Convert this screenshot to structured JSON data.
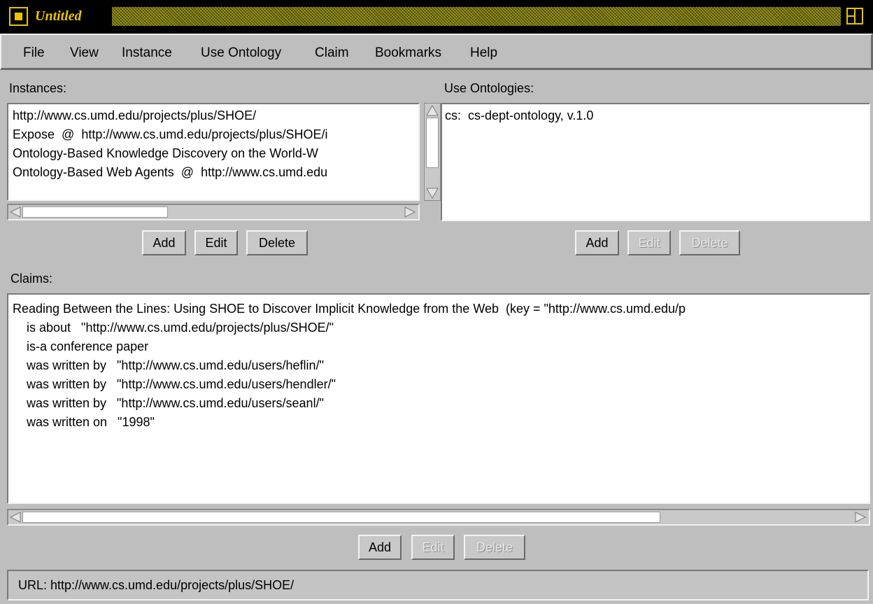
{
  "window": {
    "title": "Untitled",
    "system_menu_icon": "window-menu-icon",
    "maximize_icon": "maximize-icon"
  },
  "menubar": {
    "items": [
      "File",
      "View",
      "Instance",
      "Use Ontology",
      "Claim",
      "Bookmarks",
      "Help"
    ]
  },
  "instances": {
    "label": "Instances:",
    "items": [
      "http://www.cs.umd.edu/projects/plus/SHOE/",
      "Expose  @  http://www.cs.umd.edu/projects/plus/SHOE/i",
      "Ontology-Based Knowledge Discovery on the World-W",
      "Ontology-Based Web Agents  @  http://www.cs.umd.edu"
    ],
    "buttons": {
      "add": "Add",
      "edit": "Edit",
      "delete": "Delete"
    }
  },
  "ontologies": {
    "label": "Use Ontologies:",
    "items": [
      "cs:  cs-dept-ontology, v.1.0"
    ],
    "buttons": {
      "add": "Add",
      "edit": "Edit",
      "delete": "Delete"
    }
  },
  "claims": {
    "label": "Claims:",
    "lines": [
      "Reading Between the Lines: Using SHOE to Discover Implicit Knowledge from the Web  (key = \"http://www.cs.umd.edu/p",
      "    is about   \"http://www.cs.umd.edu/projects/plus/SHOE/\"",
      "    is-a conference paper",
      "    was written by   \"http://www.cs.umd.edu/users/heflin/\"",
      "    was written by   \"http://www.cs.umd.edu/users/hendler/\"",
      "    was written by   \"http://www.cs.umd.edu/users/seanl/\"",
      "    was written on   \"1998\""
    ],
    "buttons": {
      "add": "Add",
      "edit": "Edit",
      "delete": "Delete"
    }
  },
  "status": {
    "url_text": "URL: http://www.cs.umd.edu/projects/plus/SHOE/"
  }
}
